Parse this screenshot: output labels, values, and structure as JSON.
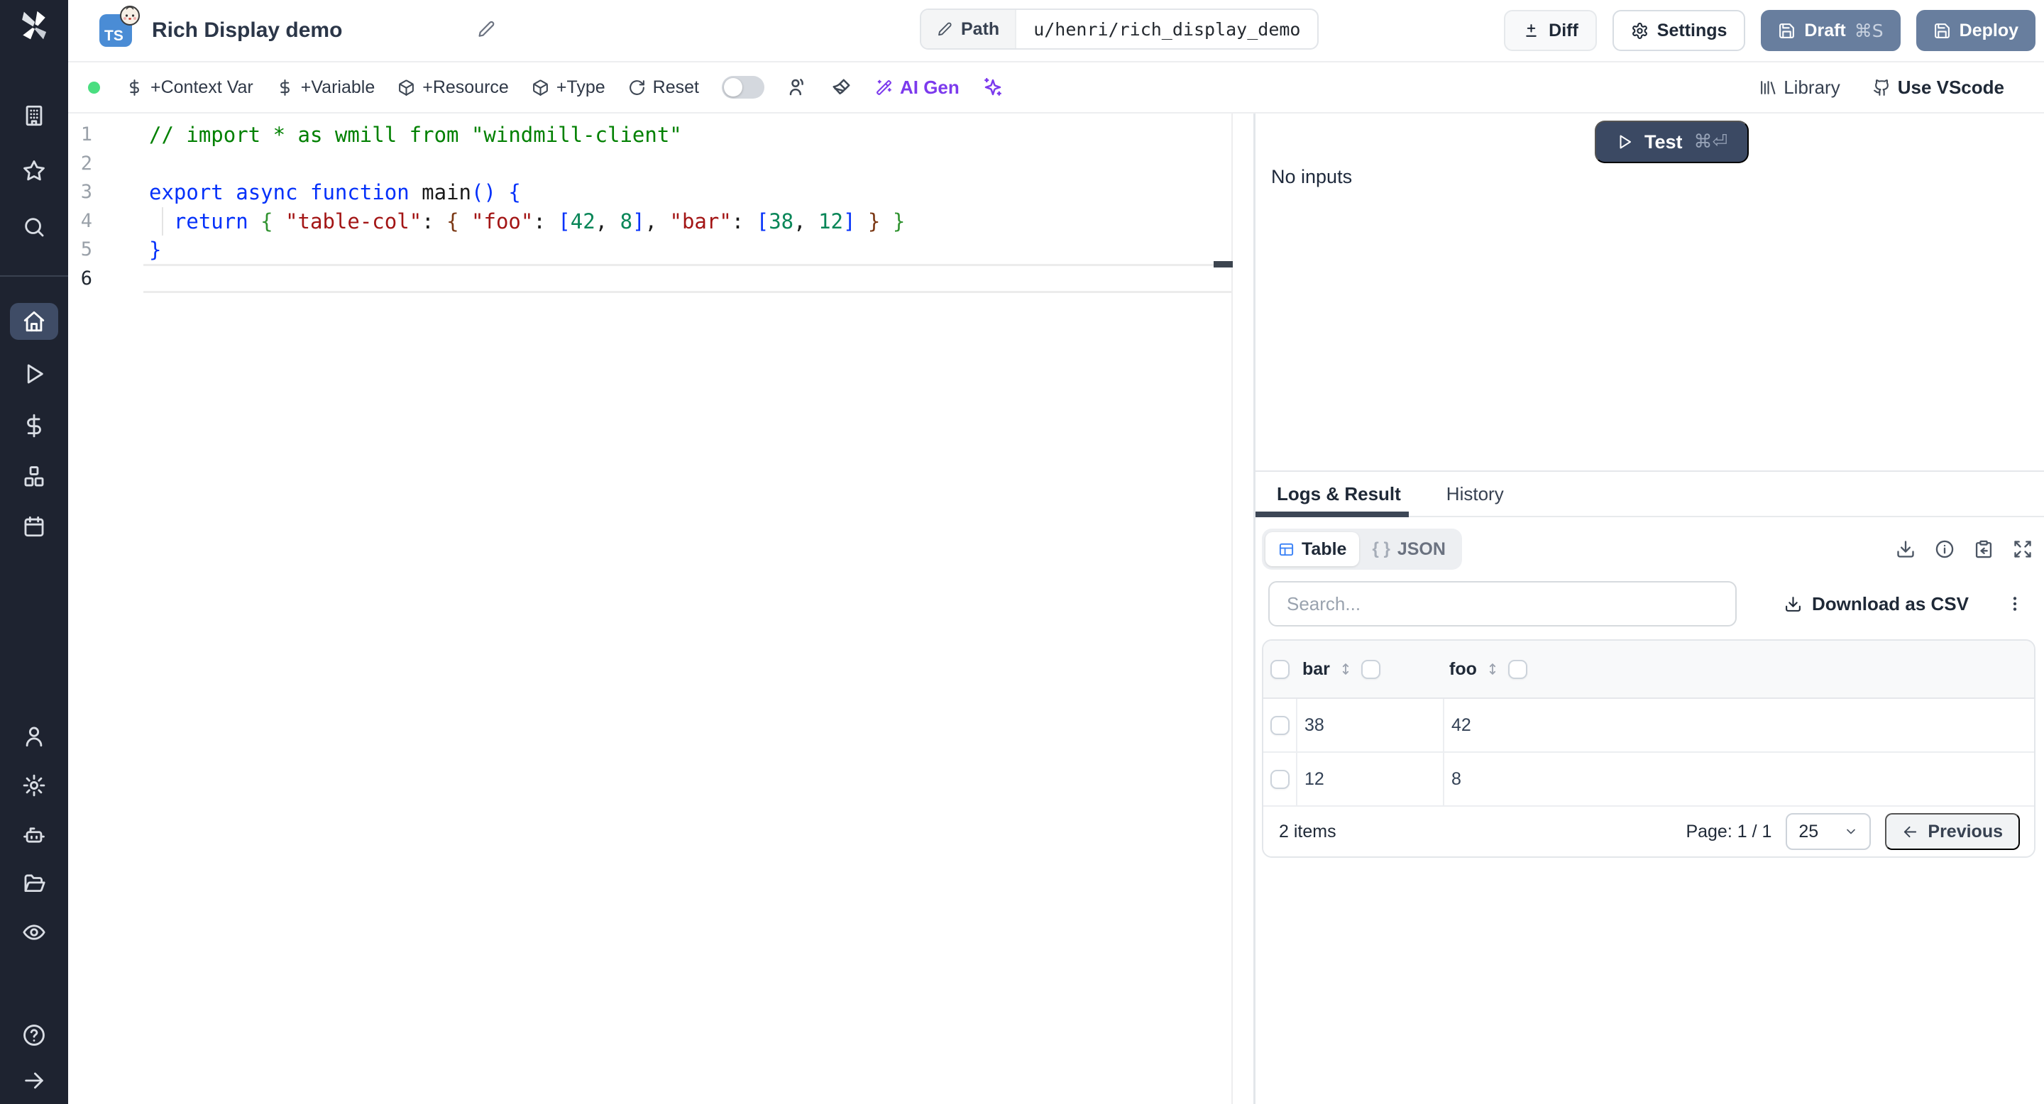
{
  "header": {
    "title": "Rich Display demo",
    "language_badge": "TS",
    "path": {
      "label": "Path",
      "value": "u/henri/rich_display_demo"
    },
    "buttons": {
      "diff": "Diff",
      "settings": "Settings",
      "draft": "Draft",
      "draft_shortcut": "⌘S",
      "deploy": "Deploy"
    }
  },
  "toolbar": {
    "context_var": "+Context Var",
    "variable": "+Variable",
    "resource": "+Resource",
    "type": "+Type",
    "reset": "Reset",
    "ai_gen": "AI Gen",
    "library": "Library",
    "vscode": "Use VScode"
  },
  "sidebar": {
    "icons": [
      "windmill-logo",
      "workspace",
      "favorites",
      "search",
      "home",
      "runs",
      "variables",
      "resources",
      "schedules",
      "user",
      "settings",
      "workers",
      "folders",
      "audit-logs",
      "help",
      "expand-sidebar"
    ]
  },
  "editor": {
    "line_numbers": [
      "1",
      "2",
      "3",
      "4",
      "5",
      "6"
    ],
    "lines": [
      [
        {
          "t": "// import * as wmill from \"windmill-client\"",
          "c": "comment"
        }
      ],
      [],
      [
        {
          "t": "export",
          "c": "kw"
        },
        {
          "t": " ",
          "c": "plain"
        },
        {
          "t": "async",
          "c": "kw"
        },
        {
          "t": " ",
          "c": "plain"
        },
        {
          "t": "function",
          "c": "kw"
        },
        {
          "t": " ",
          "c": "plain"
        },
        {
          "t": "main",
          "c": "fn"
        },
        {
          "t": "()",
          "c": "b1"
        },
        {
          "t": " ",
          "c": "plain"
        },
        {
          "t": "{",
          "c": "b1"
        }
      ],
      [
        {
          "t": "  ",
          "c": "plain"
        },
        {
          "t": "return",
          "c": "kw"
        },
        {
          "t": " ",
          "c": "plain"
        },
        {
          "t": "{",
          "c": "b2"
        },
        {
          "t": " ",
          "c": "plain"
        },
        {
          "t": "\"table-col\"",
          "c": "str"
        },
        {
          "t": ":",
          "c": "plain"
        },
        {
          "t": " ",
          "c": "plain"
        },
        {
          "t": "{",
          "c": "b3"
        },
        {
          "t": " ",
          "c": "plain"
        },
        {
          "t": "\"foo\"",
          "c": "str"
        },
        {
          "t": ":",
          "c": "plain"
        },
        {
          "t": " ",
          "c": "plain"
        },
        {
          "t": "[",
          "c": "b1"
        },
        {
          "t": "42",
          "c": "num"
        },
        {
          "t": ",",
          "c": "plain"
        },
        {
          "t": " ",
          "c": "plain"
        },
        {
          "t": "8",
          "c": "num"
        },
        {
          "t": "]",
          "c": "b1"
        },
        {
          "t": ",",
          "c": "plain"
        },
        {
          "t": " ",
          "c": "plain"
        },
        {
          "t": "\"bar\"",
          "c": "str"
        },
        {
          "t": ":",
          "c": "plain"
        },
        {
          "t": " ",
          "c": "plain"
        },
        {
          "t": "[",
          "c": "b1"
        },
        {
          "t": "38",
          "c": "num"
        },
        {
          "t": ",",
          "c": "plain"
        },
        {
          "t": " ",
          "c": "plain"
        },
        {
          "t": "12",
          "c": "num"
        },
        {
          "t": "]",
          "c": "b1"
        },
        {
          "t": " ",
          "c": "plain"
        },
        {
          "t": "}",
          "c": "b3"
        },
        {
          "t": " ",
          "c": "plain"
        },
        {
          "t": "}",
          "c": "b2"
        }
      ],
      [
        {
          "t": "}",
          "c": "b1"
        }
      ],
      []
    ]
  },
  "run": {
    "test": "Test",
    "shortcut": "⌘⏎",
    "no_inputs": "No inputs"
  },
  "result": {
    "tabs": {
      "logs": "Logs & Result",
      "history": "History"
    },
    "views": {
      "table": "Table",
      "json": "JSON",
      "json_icon": "{ }"
    },
    "search_placeholder": "Search...",
    "download_csv": "Download as CSV",
    "table": {
      "columns": [
        "bar",
        "foo"
      ],
      "rows": [
        [
          "38",
          "42"
        ],
        [
          "12",
          "8"
        ]
      ]
    },
    "footer": {
      "count": "2 items",
      "page": "Page: 1 / 1",
      "page_size": "25",
      "previous": "Previous"
    }
  },
  "colors": {
    "accent_blue": "#3b82f6",
    "slate_button": "#687e9e",
    "dark_button": "#3b4963",
    "sidebar_bg": "#1e2330",
    "active_nav": "#3f4c66",
    "ai_purple": "#7c3aed",
    "green_dot": "#4ade80",
    "ts_badge": "#4a8cd5"
  }
}
